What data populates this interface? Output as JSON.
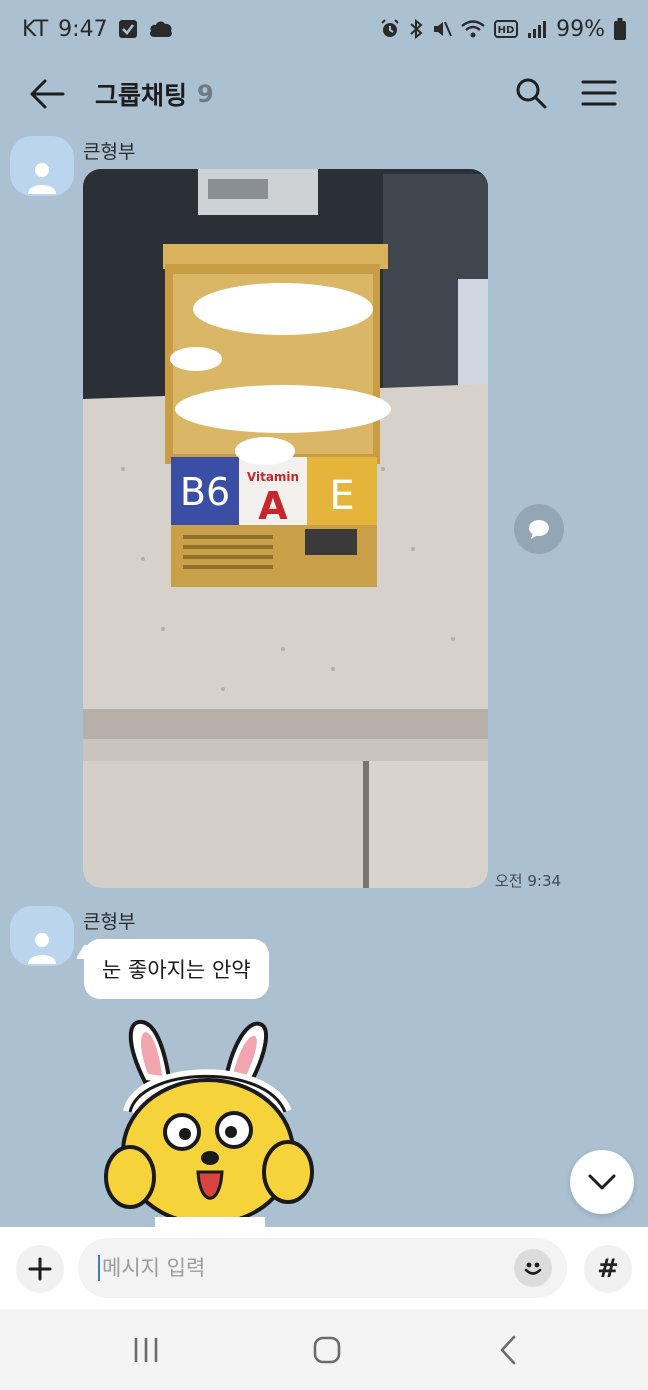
{
  "status_bar": {
    "carrier": "KT",
    "time": "9:47",
    "battery": "99%",
    "icons_left": [
      "check-icon",
      "cloud-chat-icon"
    ],
    "icons_right": [
      "alarm-icon",
      "bluetooth-icon",
      "mute-icon",
      "wifi-icon",
      "hd-icon",
      "signal-icon",
      "battery-icon"
    ]
  },
  "header": {
    "title": "그룹채팅",
    "member_count": "9"
  },
  "messages": [
    {
      "sender": "큰형부",
      "type": "photo",
      "photo_labels": {
        "b6": "B6",
        "vitamin": "Vitamin",
        "a": "A",
        "e": "E"
      },
      "time": "오전 9:34"
    },
    {
      "sender": "큰형부",
      "type": "text",
      "text": "눈 좋아지는 안약"
    },
    {
      "sender": "큰형부",
      "type": "sticker",
      "sticker_name": "rabbit-ears-character-sticker"
    }
  ],
  "input": {
    "placeholder": "메시지 입력",
    "hash_label": "#"
  },
  "colors": {
    "chat_background": "#abc1d1",
    "bubble": "#ffffff",
    "avatar": "#bcd5ee",
    "cursor": "#3a7bd5"
  }
}
